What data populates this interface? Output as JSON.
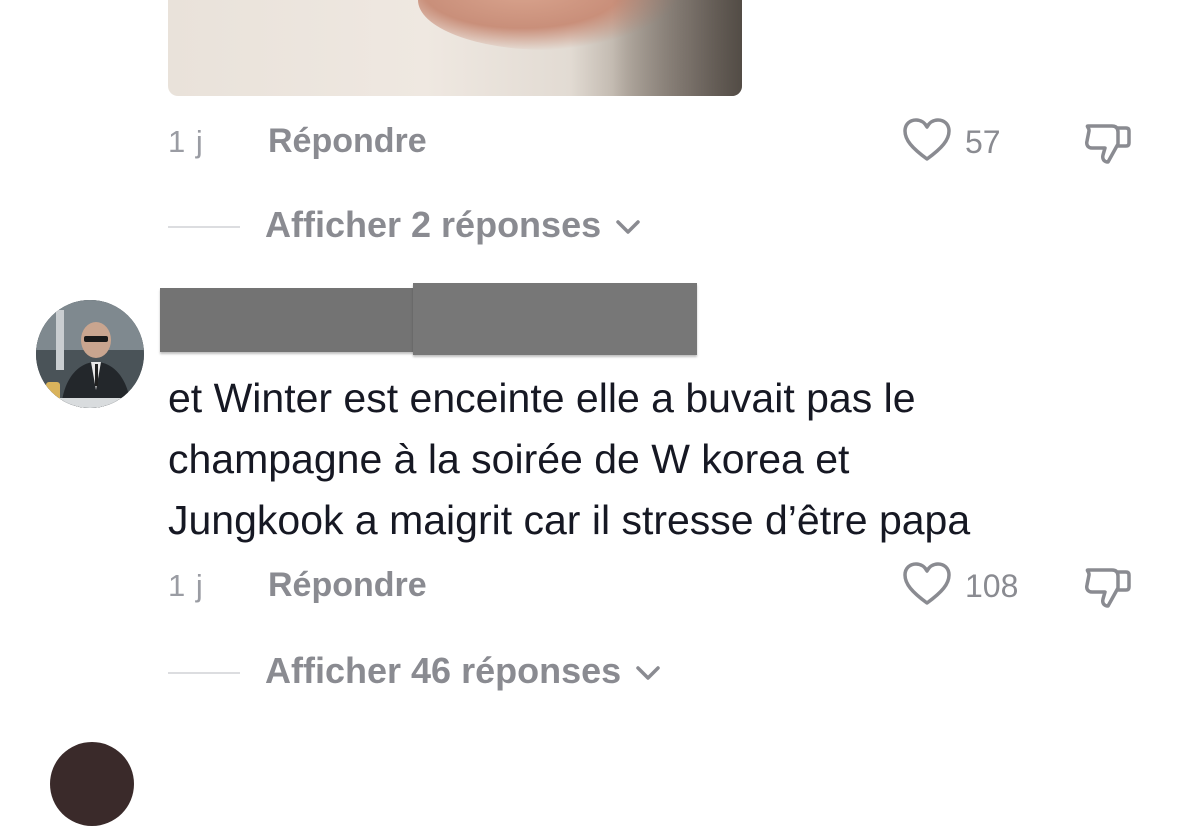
{
  "comments": [
    {
      "time": "1 j",
      "reply_label": "Répondre",
      "like_count": "57",
      "view_replies": "Afficher 2 réponses"
    },
    {
      "comment_lines": [
        "et Winter est enceinte elle a buvait pas le",
        "champagne à la soirée de W korea et",
        "Jungkook a maigrit car il stresse d’être papa"
      ],
      "time": "1 j",
      "reply_label": "Répondre",
      "like_count": "108",
      "view_replies": "Afficher 46 réponses"
    }
  ],
  "icons": {
    "like": "heart-outline-icon",
    "dislike": "thumbs-down-outline-icon",
    "expand": "chevron-down-icon"
  },
  "colors": {
    "text_primary": "#161823",
    "text_secondary": "#8a8b91",
    "redaction": "#737373"
  }
}
